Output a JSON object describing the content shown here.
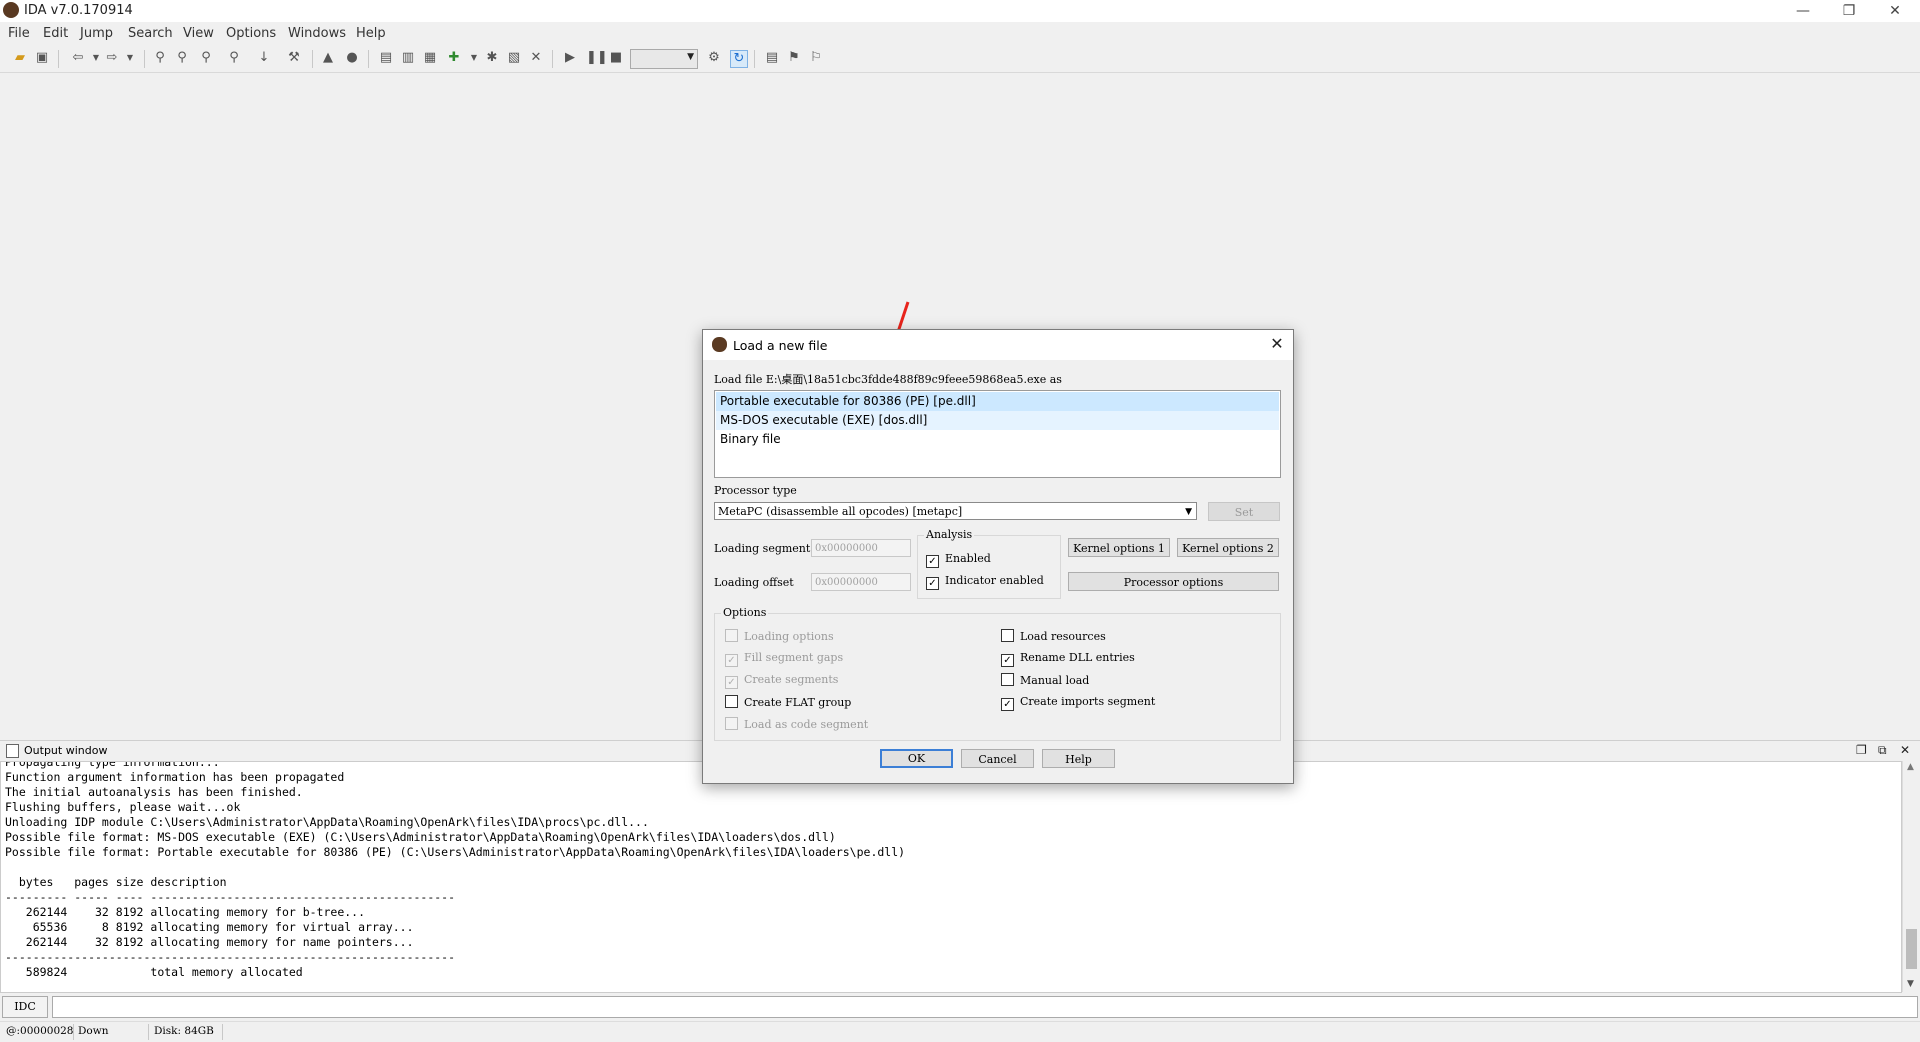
{
  "app": {
    "title": "IDA v7.0.170914",
    "window_controls": {
      "minimize": "—",
      "maximize": "❐",
      "close": "✕"
    }
  },
  "menu": [
    "File",
    "Edit",
    "Jump",
    "Search",
    "View",
    "Options",
    "Windows",
    "Help"
  ],
  "output_window": {
    "title": "Output window",
    "lines": [
      "Propagating type information...",
      "Function argument information has been propagated",
      "The initial autoanalysis has been finished.",
      "Flushing buffers, please wait...ok",
      "Unloading IDP module C:\\Users\\Administrator\\AppData\\Roaming\\OpenArk\\files\\IDA\\procs\\pc.dll...",
      "Possible file format: MS-DOS executable (EXE) (C:\\Users\\Administrator\\AppData\\Roaming\\OpenArk\\files\\IDA\\loaders\\dos.dll)",
      "Possible file format: Portable executable for 80386 (PE) (C:\\Users\\Administrator\\AppData\\Roaming\\OpenArk\\files\\IDA\\loaders\\pe.dll)",
      "",
      "  bytes   pages size description",
      "--------- ----- ---- --------------------------------------------",
      "   262144    32 8192 allocating memory for b-tree...",
      "    65536     8 8192 allocating memory for virtual array...",
      "   262144    32 8192 allocating memory for name pointers...",
      "-----------------------------------------------------------------",
      "   589824            total memory allocated"
    ]
  },
  "command": {
    "language_button": "IDC"
  },
  "status": {
    "address": "@:00000028",
    "state": "Down",
    "disk": "Disk: 84GB"
  },
  "dialog": {
    "title": "Load a new file",
    "load_file_label": "Load file E:\\桌面\\18a51cbc3fdde488f89c9feee59868ea5.exe as",
    "file_types": [
      {
        "label": "Portable executable for 80386 (PE) [pe.dll]",
        "state": "selected"
      },
      {
        "label": "MS-DOS executable (EXE) [dos.dll]",
        "state": "alt"
      },
      {
        "label": "Binary file",
        "state": "normal"
      }
    ],
    "processor_type_label": "Processor type",
    "processor_type_value": "MetaPC (disassemble all opcodes) [metapc]",
    "set_button": "Set",
    "loading_segment_label": "Loading segment",
    "loading_segment_value": "0x00000000",
    "loading_offset_label": "Loading offset",
    "loading_offset_value": "0x00000000",
    "analysis": {
      "label": "Analysis",
      "enabled": {
        "label": "Enabled",
        "checked": true
      },
      "indicator": {
        "label": "Indicator enabled",
        "checked": true
      }
    },
    "kernel_options_1": "Kernel options 1",
    "kernel_options_2": "Kernel options 2",
    "processor_options": "Processor options",
    "options_label": "Options",
    "options": {
      "loading_options": {
        "label": "Loading options",
        "checked": false,
        "disabled": true
      },
      "fill_segment_gaps": {
        "label": "Fill segment gaps",
        "checked": true,
        "disabled": true
      },
      "create_segments": {
        "label": "Create segments",
        "checked": true,
        "disabled": true
      },
      "create_flat_group": {
        "label": "Create FLAT group",
        "checked": false,
        "disabled": false
      },
      "load_as_code_segment": {
        "label": "Load as code segment",
        "checked": false,
        "disabled": true
      },
      "load_resources": {
        "label": "Load resources",
        "checked": false,
        "disabled": false
      },
      "rename_dll_entries": {
        "label": "Rename DLL entries",
        "checked": true,
        "disabled": false
      },
      "manual_load": {
        "label": "Manual load",
        "checked": false,
        "disabled": false
      },
      "create_imports_segment": {
        "label": "Create imports segment",
        "checked": true,
        "disabled": false
      }
    },
    "ok": "OK",
    "cancel": "Cancel",
    "help": "Help"
  },
  "colors": {
    "selection": "#cce8ff",
    "annotation_arrow": "#e8241c"
  }
}
